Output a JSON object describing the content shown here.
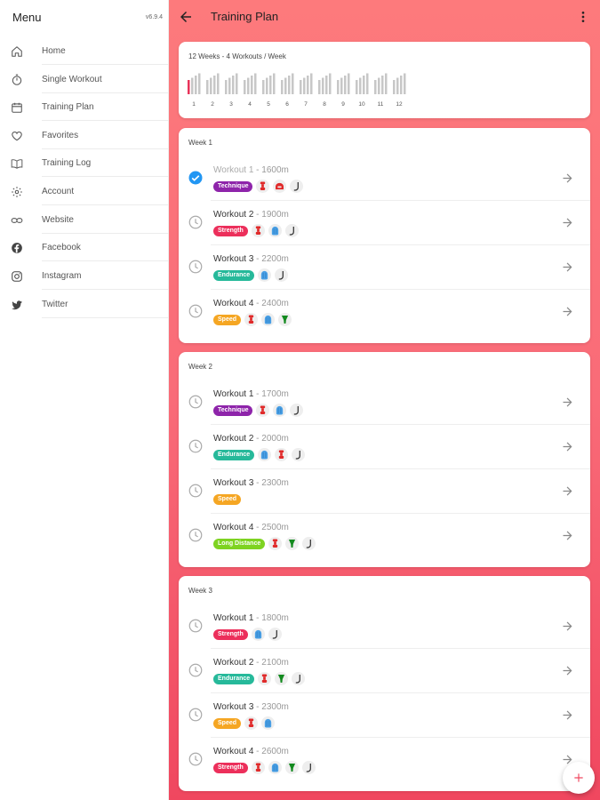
{
  "sidebar": {
    "title": "Menu",
    "version": "v6.9.4",
    "items": [
      {
        "label": "Home",
        "icon": "home-icon"
      },
      {
        "label": "Single Workout",
        "icon": "stopwatch-icon"
      },
      {
        "label": "Training Plan",
        "icon": "calendar-icon"
      },
      {
        "label": "Favorites",
        "icon": "heart-icon"
      },
      {
        "label": "Training Log",
        "icon": "book-icon"
      },
      {
        "label": "Account",
        "icon": "gear-icon"
      },
      {
        "label": "Website",
        "icon": "link-icon"
      },
      {
        "label": "Facebook",
        "icon": "facebook-icon"
      },
      {
        "label": "Instagram",
        "icon": "instagram-icon"
      },
      {
        "label": "Twitter",
        "icon": "twitter-icon"
      }
    ]
  },
  "header": {
    "title": "Training Plan"
  },
  "plan_chart": {
    "title": "12 Weeks - 4 Workouts / Week",
    "weeks": [
      "1",
      "2",
      "3",
      "4",
      "5",
      "6",
      "7",
      "8",
      "9",
      "10",
      "11",
      "12"
    ],
    "current_week_index": 0,
    "bar_color": "#c7c7c7",
    "done_color": "#e8345a"
  },
  "colors": {
    "Technique": "#8e24aa",
    "Strength": "#ec2f5b",
    "Endurance": "#26b99a",
    "Speed": "#f5a623",
    "Long Distance": "#7ed321",
    "check": "#2196f3"
  },
  "weeks": [
    {
      "title": "Week 1",
      "workouts": [
        {
          "name": "Workout 1",
          "distance": " - 1600m",
          "tag": "Technique",
          "equipment": [
            "pull-buoy-icon",
            "kickboard-icon",
            "snorkel-icon"
          ],
          "done": true
        },
        {
          "name": "Workout 2",
          "distance": " - 1900m",
          "tag": "Strength",
          "equipment": [
            "pull-buoy-icon",
            "paddles-icon",
            "snorkel-icon"
          ],
          "done": false
        },
        {
          "name": "Workout 3",
          "distance": " - 2200m",
          "tag": "Endurance",
          "equipment": [
            "paddles-icon",
            "snorkel-icon"
          ],
          "done": false
        },
        {
          "name": "Workout 4",
          "distance": " - 2400m",
          "tag": "Speed",
          "equipment": [
            "pull-buoy-icon",
            "paddles-icon",
            "fins-icon"
          ],
          "done": false
        }
      ]
    },
    {
      "title": "Week 2",
      "workouts": [
        {
          "name": "Workout 1",
          "distance": " - 1700m",
          "tag": "Technique",
          "equipment": [
            "pull-buoy-icon",
            "paddles-icon",
            "snorkel-icon"
          ],
          "done": false
        },
        {
          "name": "Workout 2",
          "distance": " - 2000m",
          "tag": "Endurance",
          "equipment": [
            "paddles-icon",
            "pull-buoy-icon",
            "snorkel-icon"
          ],
          "done": false
        },
        {
          "name": "Workout 3",
          "distance": " - 2300m",
          "tag": "Speed",
          "equipment": [],
          "done": false
        },
        {
          "name": "Workout 4",
          "distance": " - 2500m",
          "tag": "Long Distance",
          "equipment": [
            "pull-buoy-icon",
            "fins-icon",
            "snorkel-icon"
          ],
          "done": false
        }
      ]
    },
    {
      "title": "Week 3",
      "workouts": [
        {
          "name": "Workout 1",
          "distance": " - 1800m",
          "tag": "Strength",
          "equipment": [
            "paddles-icon",
            "snorkel-icon"
          ],
          "done": false
        },
        {
          "name": "Workout 2",
          "distance": " - 2100m",
          "tag": "Endurance",
          "equipment": [
            "pull-buoy-icon",
            "fins-icon",
            "snorkel-icon"
          ],
          "done": false
        },
        {
          "name": "Workout 3",
          "distance": " - 2300m",
          "tag": "Speed",
          "equipment": [
            "pull-buoy-icon",
            "paddles-icon"
          ],
          "done": false
        },
        {
          "name": "Workout 4",
          "distance": " - 2600m",
          "tag": "Strength",
          "equipment": [
            "pull-buoy-icon",
            "paddles-icon",
            "fins-icon",
            "snorkel-icon"
          ],
          "done": false
        }
      ]
    }
  ]
}
